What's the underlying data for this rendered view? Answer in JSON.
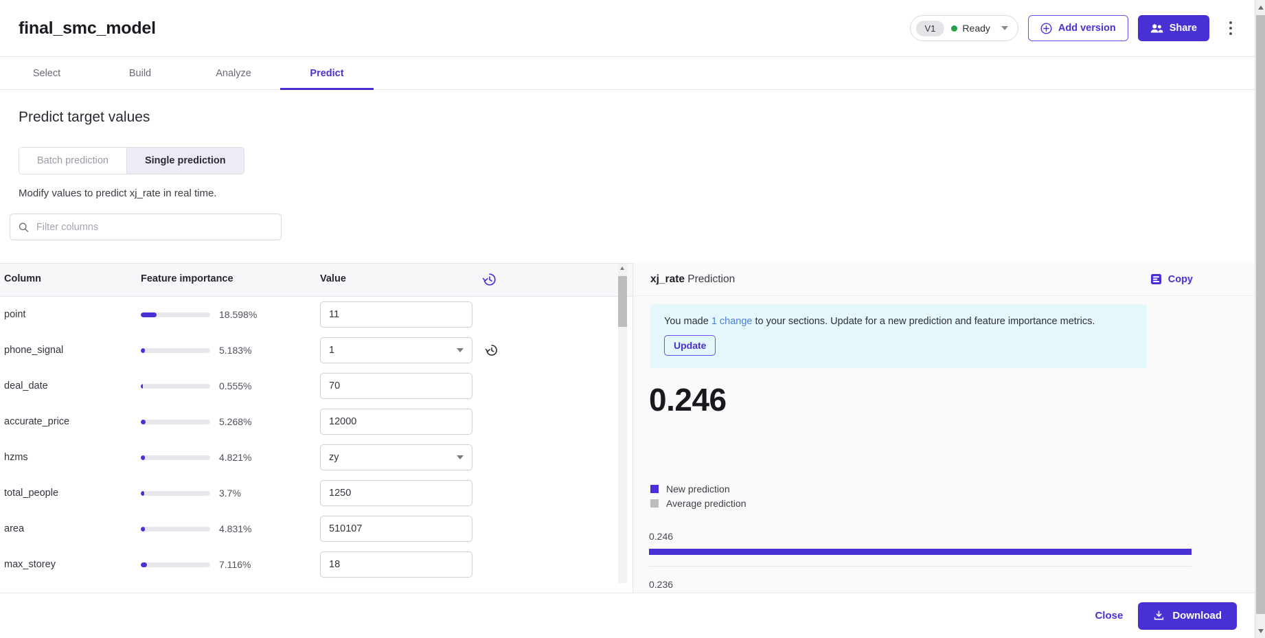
{
  "header": {
    "title": "final_smc_model",
    "version_label": "V1",
    "status_label": "Ready",
    "status_color": "#22a447",
    "add_version_label": "Add version",
    "share_label": "Share",
    "more_icon": "kebab-menu-icon"
  },
  "tabs": [
    {
      "label": "Select",
      "active": false
    },
    {
      "label": "Build",
      "active": false
    },
    {
      "label": "Analyze",
      "active": false
    },
    {
      "label": "Predict",
      "active": true
    }
  ],
  "main": {
    "section_title": "Predict target values",
    "segments": [
      {
        "label": "Batch prediction",
        "active": false
      },
      {
        "label": "Single prediction",
        "active": true
      }
    ],
    "sub_note": "Modify values to predict xj_rate in real time.",
    "search_placeholder": "Filter columns",
    "search_value": ""
  },
  "table": {
    "headers": [
      "Column",
      "Feature importance",
      "Value"
    ],
    "history_icon": "history-revert-icon",
    "rows": [
      {
        "column": "point",
        "importance": 18.598,
        "importance_label": "18.598%",
        "value": "11",
        "input_type": "text",
        "has_revert": false
      },
      {
        "column": "phone_signal",
        "importance": 5.183,
        "importance_label": "5.183%",
        "value": "1",
        "input_type": "select",
        "has_revert": true
      },
      {
        "column": "deal_date",
        "importance": 0.555,
        "importance_label": "0.555%",
        "value": "70",
        "input_type": "text",
        "has_revert": false
      },
      {
        "column": "accurate_price",
        "importance": 5.268,
        "importance_label": "5.268%",
        "value": "12000",
        "input_type": "text",
        "has_revert": false
      },
      {
        "column": "hzms",
        "importance": 4.821,
        "importance_label": "4.821%",
        "value": "zy",
        "input_type": "select",
        "has_revert": false
      },
      {
        "column": "total_people",
        "importance": 3.7,
        "importance_label": "3.7%",
        "value": "1250",
        "input_type": "text",
        "has_revert": false
      },
      {
        "column": "area",
        "importance": 4.831,
        "importance_label": "4.831%",
        "value": "510107",
        "input_type": "text",
        "has_revert": false
      },
      {
        "column": "max_storey",
        "importance": 7.116,
        "importance_label": "7.116%",
        "value": "18",
        "input_type": "text",
        "has_revert": false
      }
    ]
  },
  "prediction": {
    "target_name": "xj_rate",
    "title_suffix": " Prediction",
    "copy_label": "Copy",
    "copy_icon": "copy-document-icon",
    "alert_prefix": "You made ",
    "alert_link": "1 change",
    "alert_suffix": " to your sections. Update for a new prediction and feature importance metrics.",
    "update_label": "Update",
    "big_value": "0.246",
    "legend": [
      {
        "label": "New prediction",
        "color": "#4731d4"
      },
      {
        "label": "Average prediction",
        "color": "#bdbdbd"
      }
    ],
    "chart_data": {
      "type": "bar",
      "title": "xj_rate Prediction",
      "orientation": "horizontal",
      "categories": [
        "New prediction",
        "Average prediction"
      ],
      "values": [
        0.246,
        0.236
      ],
      "labels": [
        "0.246",
        "0.236"
      ],
      "colors": [
        "#4731d4",
        "#bdbdbd"
      ],
      "xlabel": "",
      "ylabel": "",
      "xlim": [
        0,
        0.246
      ],
      "grid": false,
      "legend_position": "top-left"
    }
  },
  "footer": {
    "close_label": "Close",
    "download_label": "Download",
    "download_icon": "download-icon"
  }
}
